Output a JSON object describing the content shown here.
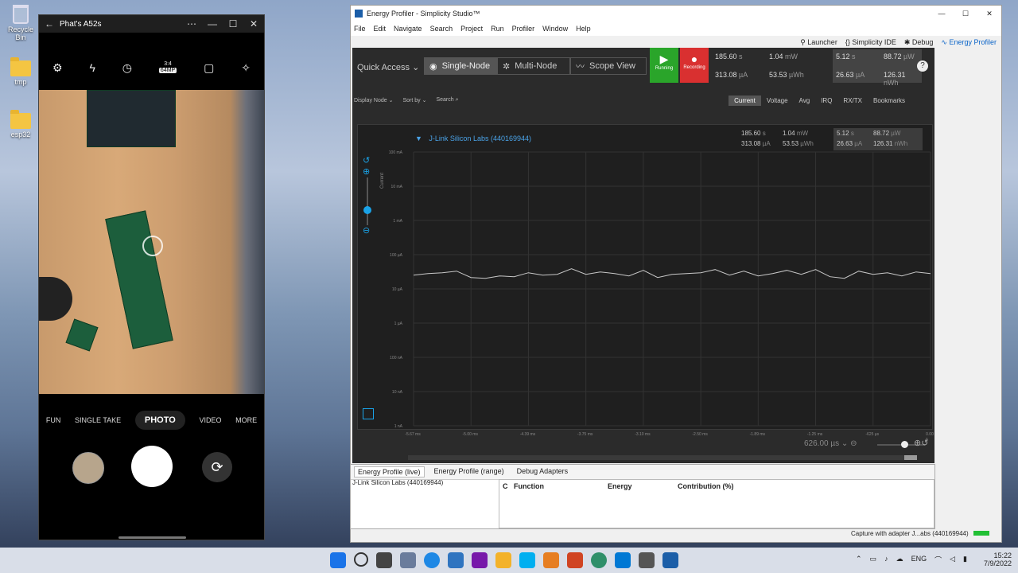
{
  "desktop": {
    "icons": [
      {
        "label": "Recycle Bin"
      },
      {
        "label": "tmp"
      },
      {
        "label": "esp32"
      }
    ]
  },
  "phone": {
    "title": "Phat's A52s",
    "aspect": "3:4",
    "megapixels": "64MP",
    "modes": [
      "FUN",
      "SINGLE TAKE",
      "PHOTO",
      "VIDEO",
      "MORE"
    ]
  },
  "profiler": {
    "title": "Energy Profiler - Simplicity Studio™",
    "menu": [
      "File",
      "Edit",
      "Navigate",
      "Search",
      "Project",
      "Run",
      "Profiler",
      "Window",
      "Help"
    ],
    "perspectives": [
      "Launcher",
      "Simplicity IDE",
      "Debug",
      "Energy Profiler"
    ],
    "quick_access": "Quick Access",
    "node_modes": [
      "Single-Node",
      "Multi-Node",
      "Scope View"
    ],
    "running_label": "Running",
    "recording_label": "Recording",
    "top_values": {
      "time": "185.60",
      "time_unit": "s",
      "current": "313.08",
      "current_unit": "µA",
      "power": "1.04",
      "power_unit": "mW",
      "energy": "53.53",
      "energy_unit": "µWh",
      "sel_a": "5.12",
      "sel_a_unit": "s",
      "sel_b": "26.63",
      "sel_b_unit": "µA",
      "sel_c": "88.72",
      "sel_c_unit": "µW",
      "sel_d": "126.31",
      "sel_d_unit": "nWh"
    },
    "toolbar": {
      "display_node": "Display Node",
      "sort_by": "Sort by",
      "search": "Search"
    },
    "view_tabs": [
      "Current",
      "Voltage",
      "Avg",
      "IRQ",
      "RX/TX",
      "Bookmarks"
    ],
    "device": "J-Link Silicon Labs (440169944)",
    "ylabel": "Current",
    "y_ticks": [
      "100 mA",
      "10 mA",
      "1 mA",
      "100 µA",
      "10 µA",
      "1 µA",
      "100 nA",
      "10 nA",
      "1 nA"
    ],
    "x_ticks": [
      "-5.67 ms",
      "-5.00 ms",
      "-4.39 ms",
      "-3.75 ms",
      "-3.10 ms",
      "-2.50 ms",
      "-1.89 ms",
      "-1.25 ms",
      "-625 µs",
      "0.00 s"
    ],
    "zoom_value": "626.00 µs",
    "bottom_tabs": [
      "Energy Profile (live)",
      "Energy Profile (range)",
      "Debug Adapters"
    ],
    "bottom_device": "J-Link Silicon Labs (440169944)",
    "table_headers": [
      "C",
      "Function",
      "Energy",
      "Contribution (%)"
    ],
    "status": "Capture with adapter J...abs (440169944)"
  },
  "taskbar": {
    "lang": "ENG",
    "time": "15:22",
    "date": "7/9/2022"
  },
  "colors": {
    "running": "#2aa52a",
    "recording": "#d93030",
    "accent": "#0a64c8",
    "plot_line": "#c8c8c8",
    "handle": "#1aa3e8"
  }
}
